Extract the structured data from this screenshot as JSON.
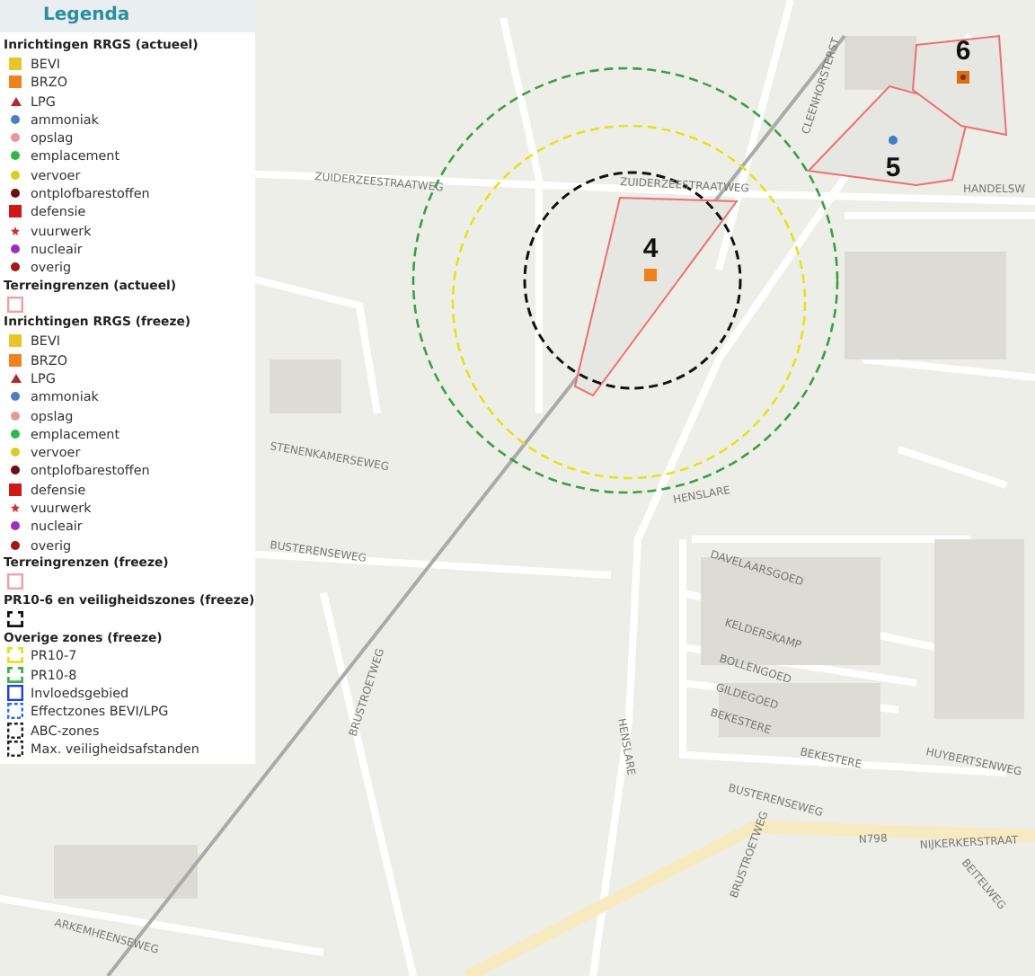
{
  "legend": {
    "title": "Legenda",
    "sections": [
      {
        "heading": "Inrichtingen RRGS (actueel)",
        "items": [
          {
            "label": "BEVI",
            "kind": "square",
            "color": "#e6c62a"
          },
          {
            "label": "BRZO",
            "kind": "square",
            "color": "#f08020"
          },
          {
            "label": "LPG",
            "kind": "triangle",
            "color": "#b02a2a"
          },
          {
            "label": "ammoniak",
            "kind": "dot",
            "color": "#4a7fc0"
          },
          {
            "label": "opslag",
            "kind": "dot",
            "color": "#e89898"
          },
          {
            "label": "emplacement",
            "kind": "dot",
            "color": "#2fb84a"
          },
          {
            "label": "vervoer",
            "kind": "dot",
            "color": "#d8d020"
          },
          {
            "label": "ontplofbarestoffen",
            "kind": "dot",
            "color": "#6a1010"
          },
          {
            "label": "defensie",
            "kind": "square",
            "color": "#d01818"
          },
          {
            "label": "vuurwerk",
            "kind": "star",
            "color": "#d03030"
          },
          {
            "label": "nucleair",
            "kind": "dot",
            "color": "#9a30c0"
          },
          {
            "label": "overig",
            "kind": "dot",
            "color": "#a01818"
          }
        ]
      },
      {
        "heading": "Terreingrenzen (actueel)",
        "items": [
          {
            "kind": "outline",
            "color": "#f0a0a0"
          }
        ]
      },
      {
        "heading": "Inrichtingen RRGS (freeze)",
        "items": [
          {
            "label": "BEVI",
            "kind": "square",
            "color": "#e6c62a"
          },
          {
            "label": "BRZO",
            "kind": "square",
            "color": "#f08020"
          },
          {
            "label": "LPG",
            "kind": "triangle",
            "color": "#b02a2a"
          },
          {
            "label": "ammoniak",
            "kind": "dot",
            "color": "#4a7fc0"
          },
          {
            "label": "opslag",
            "kind": "dot",
            "color": "#e89898"
          },
          {
            "label": "emplacement",
            "kind": "dot",
            "color": "#2fb84a"
          },
          {
            "label": "vervoer",
            "kind": "dot",
            "color": "#d8d020"
          },
          {
            "label": "ontplofbarestoffen",
            "kind": "dot",
            "color": "#6a1010"
          },
          {
            "label": "defensie",
            "kind": "square",
            "color": "#d01818"
          },
          {
            "label": "vuurwerk",
            "kind": "star",
            "color": "#d03030"
          },
          {
            "label": "nucleair",
            "kind": "dot",
            "color": "#9a30c0"
          },
          {
            "label": "overig",
            "kind": "dot",
            "color": "#a01818"
          }
        ]
      },
      {
        "heading": "Terreingrenzen (freeze)",
        "items": [
          {
            "kind": "outline",
            "color": "#f0a0a0"
          }
        ]
      },
      {
        "heading": "PR10-6 en veiligheidszones (freeze)",
        "items": [
          {
            "kind": "bracket",
            "color": "#111111"
          }
        ]
      },
      {
        "heading": "Overige zones (freeze)",
        "items": [
          {
            "label": "PR10-7",
            "kind": "bracket",
            "color": "#e8e020"
          },
          {
            "label": "PR10-8",
            "kind": "bracket",
            "color": "#40b040"
          },
          {
            "label": "Invloedsgebied",
            "kind": "outline",
            "color": "#2040e0"
          },
          {
            "label": "Effectzones BEVI/LPG",
            "kind": "dashed",
            "color": "#3070e0"
          },
          {
            "label": "ABC-zones",
            "kind": "dashed",
            "color": "#222222"
          },
          {
            "label": "Max. veiligheidsafstanden",
            "kind": "dashed",
            "color": "#222222"
          }
        ]
      }
    ]
  },
  "map": {
    "sites": [
      {
        "label": "4",
        "kind": "square",
        "color": "#f08020"
      },
      {
        "label": "5",
        "kind": "dot",
        "color": "#3f7fc6"
      },
      {
        "label": "6",
        "kind": "ring-square",
        "color": "#d9700f"
      }
    ],
    "streets": [
      "ZUIDERZEESTRAATWEG",
      "ZUIDERZEESTRAATWEG",
      "CLEENHORSTERST",
      "HANDELSW",
      "STENENKAMERSEWEG",
      "BUSTERENSEWEG",
      "BRUSTROETWEG",
      "DAVELAARSGOED",
      "KELDERSKAMP",
      "BOLLENGOED",
      "GILDEGOED",
      "BEKESTERE",
      "BEKESTERE",
      "HUYBERTSENWEG",
      "HENSLARE",
      "HENSLARE",
      "BUSTERENSEWEG",
      "N798",
      "NIJKERKERSTRAAT",
      "BEITELWEG",
      "ARKEMHEENSEWEG",
      "BRUSTROETWEG"
    ]
  }
}
